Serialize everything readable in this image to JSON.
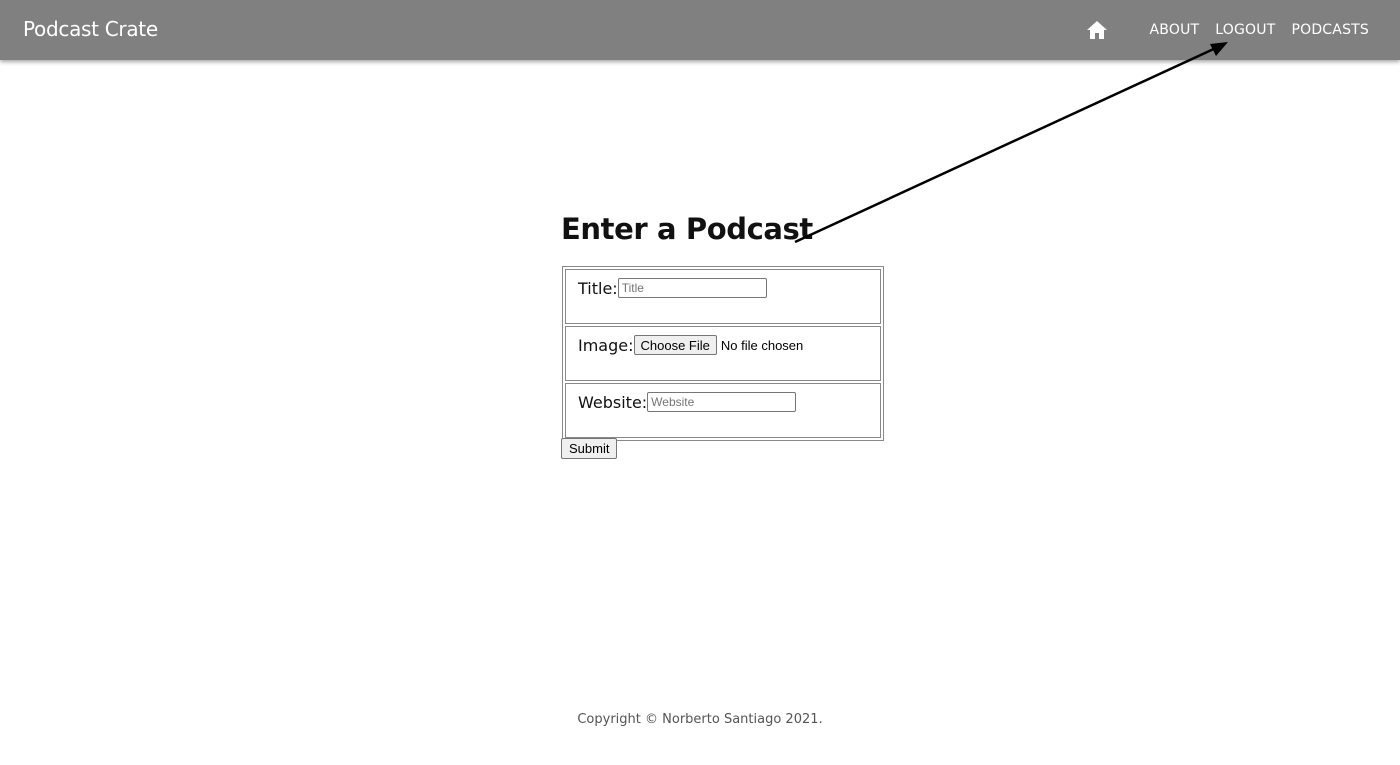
{
  "appbar": {
    "brand": "Podcast Crate",
    "home_icon": "home-icon",
    "links": [
      "ABOUT",
      "LOGOUT",
      "PODCASTS"
    ],
    "background": "#808080"
  },
  "main": {
    "heading": "Enter a Podcast",
    "fields": {
      "title": {
        "label": "Title:",
        "placeholder": "Title",
        "value": ""
      },
      "image": {
        "label": "Image:",
        "button": "Choose File",
        "status": "No file chosen"
      },
      "website": {
        "label": "Website:",
        "placeholder": "Website",
        "value": ""
      }
    },
    "submit": "Submit"
  },
  "footer": {
    "copyright": "Copyright © Norberto Santiago 2021."
  },
  "annotation": {
    "arrow_icon": "arrow-pointing-to-logout",
    "color": "#000000"
  }
}
